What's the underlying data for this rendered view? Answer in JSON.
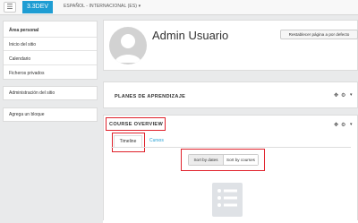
{
  "navbar": {
    "menu_icon": "hamburger-icon",
    "brand": "3.3DEV",
    "language": "ESPAÑOL - INTERNACIONAL (ES)",
    "language_caret": "▾"
  },
  "sidebar": {
    "nav": [
      {
        "label": "Área personal"
      },
      {
        "label": "Inicio del sitio"
      },
      {
        "label": "Calendario"
      },
      {
        "label": "Ficheros privados"
      }
    ],
    "admin": "Administración del sitio",
    "add_block": "Agrega un bloque"
  },
  "header": {
    "user_name": "Admin Usuario",
    "reset_button": "Restablecer página a por defecto"
  },
  "learning_plans": {
    "title": "PLANES DE APRENDIZAJE",
    "move_icon": "move-icon",
    "gear_icon": "gear-icon",
    "menu_caret": "▾"
  },
  "course_overview": {
    "title": "COURSE OVERVIEW",
    "tabs": [
      {
        "label": "Timeline",
        "active": true
      },
      {
        "label": "Cursos",
        "active": false
      }
    ],
    "sort": {
      "by_dates": "Sort by dates",
      "by_courses": "Sort by courses",
      "selected": "Sort by dates"
    },
    "empty_icon": "empty-list-icon"
  },
  "colors": {
    "brand": "#1e9dd3",
    "highlight": "#e0212b",
    "link": "#1e9dd3"
  }
}
